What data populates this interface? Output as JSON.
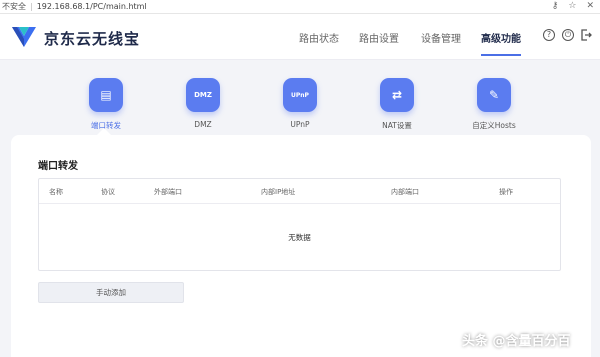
{
  "browser": {
    "security_label": "不安全",
    "url": "192.168.68.1/PC/main.html",
    "key_icon": "key-icon",
    "star_icon": "star-icon",
    "close_icon": "close-icon"
  },
  "header": {
    "brand": "京东云无线宝",
    "nav": [
      {
        "label": "路由状态",
        "active": false
      },
      {
        "label": "路由设置",
        "active": false
      },
      {
        "label": "设备管理",
        "active": false
      },
      {
        "label": "高级功能",
        "active": true
      }
    ],
    "icons": [
      "help-icon",
      "power-icon",
      "logout-icon"
    ]
  },
  "features": [
    {
      "label": "端口转发",
      "glyph": "▤",
      "icon": "port-forward-icon",
      "active": true
    },
    {
      "label": "DMZ",
      "glyph": "DMZ",
      "icon": "dmz-icon",
      "active": false
    },
    {
      "label": "UPnP",
      "glyph": "UPnP",
      "icon": "upnp-icon",
      "active": false
    },
    {
      "label": "NAT设置",
      "glyph": "⇄",
      "icon": "nat-icon",
      "active": false
    },
    {
      "label": "自定义Hosts",
      "glyph": "✎",
      "icon": "hosts-icon",
      "active": false
    }
  ],
  "panel": {
    "title": "端口转发",
    "columns": [
      "名称",
      "协议",
      "外部端口",
      "内部IP地址",
      "内部端口",
      "操作"
    ],
    "empty_text": "无数据",
    "add_button": "手动添加"
  },
  "watermark": "头条 @含量百分百",
  "colors": {
    "accent": "#5b7cf0",
    "background": "#f3f4f8"
  }
}
